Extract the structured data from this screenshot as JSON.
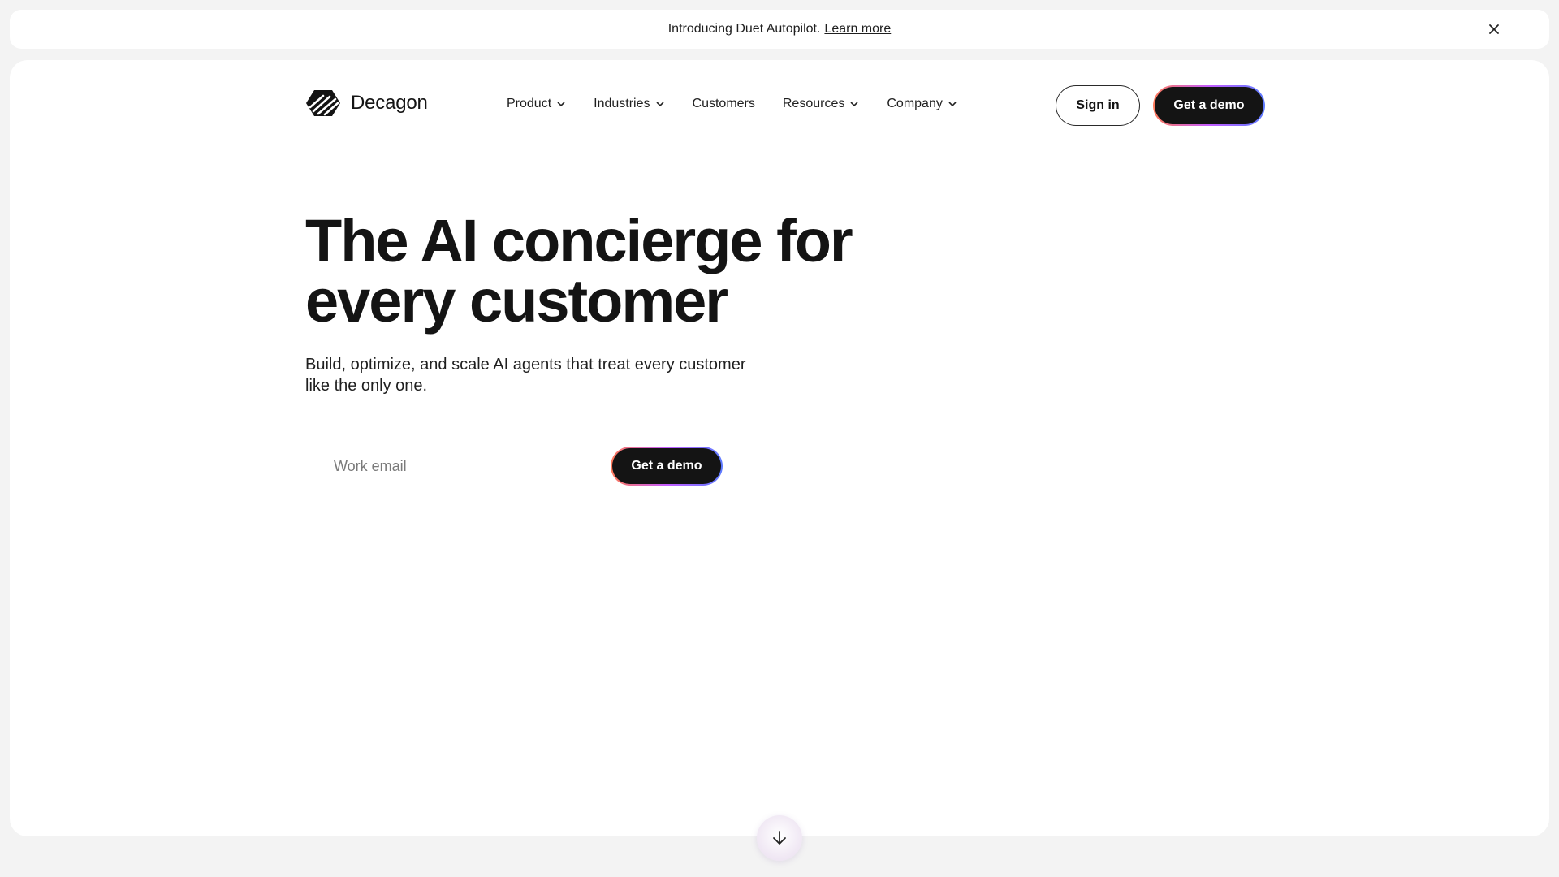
{
  "announcement": {
    "text": "Introducing Duet Autopilot.",
    "link": "Learn more",
    "close_icon": "close-icon"
  },
  "brand": {
    "name": "Decagon",
    "logo_icon": "decagon-logo-icon"
  },
  "nav": {
    "items": [
      {
        "label": "Product",
        "has_dropdown": true
      },
      {
        "label": "Industries",
        "has_dropdown": true
      },
      {
        "label": "Customers",
        "has_dropdown": false
      },
      {
        "label": "Resources",
        "has_dropdown": true
      },
      {
        "label": "Company",
        "has_dropdown": true
      }
    ],
    "sign_in": "Sign in",
    "get_demo": "Get a demo"
  },
  "hero": {
    "title_line1": "The AI concierge for",
    "title_line2": "every customer",
    "subtitle_line1": "Build, optimize, and scale AI agents that treat every customer",
    "subtitle_line2": "like the only one.",
    "email_placeholder": "Work email",
    "cta": "Get a demo"
  },
  "scroll": {
    "icon": "arrow-down-icon"
  },
  "colors": {
    "page_bg": "#f3f3f3",
    "card_bg": "#ffffff",
    "text": "#141414",
    "button_dark": "#141414",
    "gradient_border": [
      "#ff7a59",
      "#c45cff",
      "#5c7bff"
    ]
  }
}
